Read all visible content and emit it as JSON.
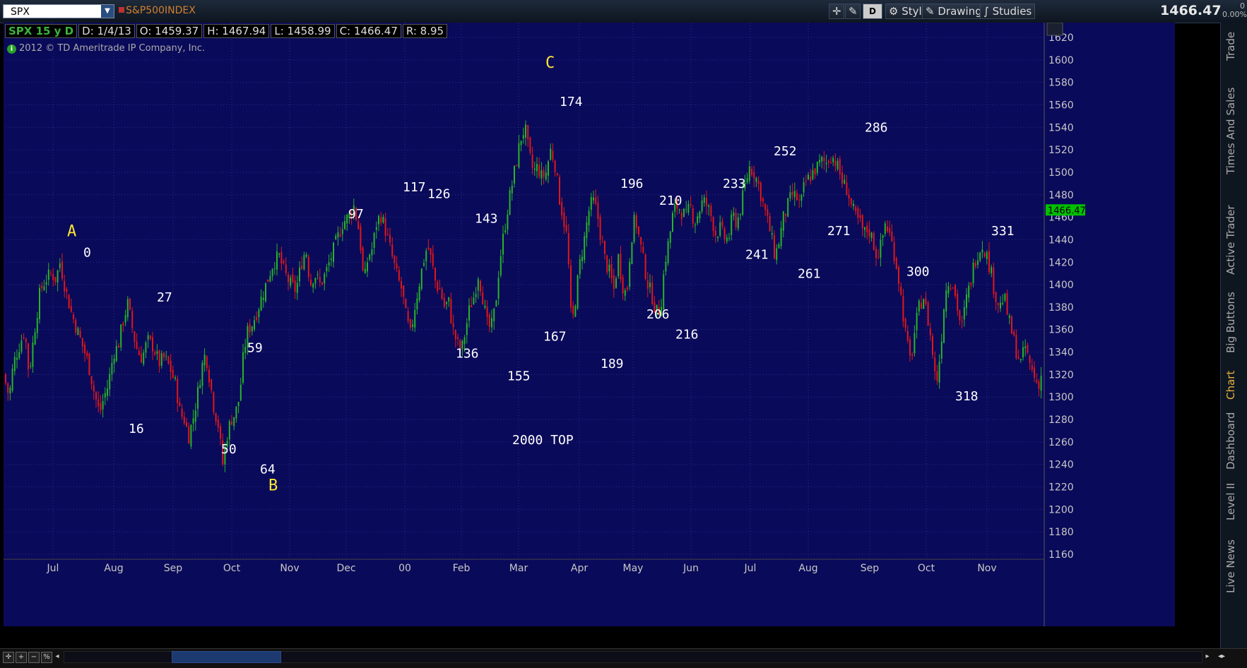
{
  "toolbar": {
    "symbol": "SPX",
    "description": "S&P500INDEX",
    "period_btn": "D",
    "style_label": "Style",
    "drawings_label": "Drawings",
    "studies_label": "Studies",
    "last_price": "1466.47",
    "change_top": "0",
    "change_pct": "0.00%"
  },
  "info_bar": {
    "symbol_period": "SPX 15 y D",
    "date": "D: 1/4/13",
    "open": "O: 1459.37",
    "high": "H: 1467.94",
    "low": "L: 1458.99",
    "close": "C: 1466.47",
    "range": "R: 8.95"
  },
  "copyright": "2012 © TD Ameritrade IP Company, Inc.",
  "side_tabs": [
    "Trade",
    "Times And Sales",
    "Active Trader",
    "Big Buttons",
    "Chart",
    "Dashboard",
    "Level II",
    "Live News"
  ],
  "side_active": "Chart",
  "colors": {
    "background": "#0a0a5a",
    "up_candle": "#28b428",
    "down_candle": "#e01818",
    "annotation": "#ffffff",
    "wave_label": "#ffe830",
    "price_tag": "#00c000"
  },
  "chart_data": {
    "type": "candlestick",
    "title": "",
    "xlabel": "",
    "ylabel": "",
    "ylim": [
      1160,
      1620
    ],
    "y_ticks": [
      1160,
      1180,
      1200,
      1220,
      1240,
      1260,
      1280,
      1300,
      1320,
      1340,
      1360,
      1380,
      1400,
      1420,
      1440,
      1460,
      1480,
      1500,
      1520,
      1540,
      1560,
      1580,
      1600,
      1620
    ],
    "x_months": [
      "Jul",
      "Aug",
      "Sep",
      "Oct",
      "Nov",
      "Dec",
      "00",
      "Feb",
      "Mar",
      "Apr",
      "May",
      "Jun",
      "Jul",
      "Aug",
      "Sep",
      "Oct",
      "Nov"
    ],
    "current_price_tag": "1466.47",
    "path_anchors": [
      [
        0,
        1320
      ],
      [
        8,
        1300
      ],
      [
        14,
        1330
      ],
      [
        22,
        1345
      ],
      [
        30,
        1360
      ],
      [
        36,
        1320
      ],
      [
        44,
        1360
      ],
      [
        52,
        1395
      ],
      [
        60,
        1405
      ],
      [
        68,
        1410
      ],
      [
        74,
        1405
      ],
      [
        80,
        1420
      ],
      [
        88,
        1395
      ],
      [
        96,
        1375
      ],
      [
        104,
        1360
      ],
      [
        112,
        1345
      ],
      [
        120,
        1330
      ],
      [
        128,
        1305
      ],
      [
        136,
        1285
      ],
      [
        142,
        1300
      ],
      [
        148,
        1310
      ],
      [
        156,
        1340
      ],
      [
        162,
        1345
      ],
      [
        170,
        1370
      ],
      [
        176,
        1383
      ],
      [
        184,
        1355
      ],
      [
        190,
        1340
      ],
      [
        196,
        1335
      ],
      [
        204,
        1350
      ],
      [
        212,
        1345
      ],
      [
        220,
        1330
      ],
      [
        228,
        1335
      ],
      [
        236,
        1325
      ],
      [
        244,
        1310
      ],
      [
        250,
        1285
      ],
      [
        256,
        1280
      ],
      [
        262,
        1265
      ],
      [
        268,
        1280
      ],
      [
        274,
        1300
      ],
      [
        280,
        1325
      ],
      [
        286,
        1340
      ],
      [
        292,
        1315
      ],
      [
        298,
        1290
      ],
      [
        304,
        1275
      ],
      [
        310,
        1240
      ],
      [
        316,
        1265
      ],
      [
        322,
        1280
      ],
      [
        328,
        1285
      ],
      [
        334,
        1300
      ],
      [
        340,
        1340
      ],
      [
        346,
        1360
      ],
      [
        352,
        1365
      ],
      [
        358,
        1375
      ],
      [
        366,
        1390
      ],
      [
        374,
        1405
      ],
      [
        382,
        1420
      ],
      [
        390,
        1425
      ],
      [
        398,
        1410
      ],
      [
        406,
        1400
      ],
      [
        414,
        1395
      ],
      [
        422,
        1420
      ],
      [
        428,
        1432
      ],
      [
        434,
        1400
      ],
      [
        440,
        1410
      ],
      [
        448,
        1400
      ],
      [
        456,
        1410
      ],
      [
        464,
        1425
      ],
      [
        472,
        1440
      ],
      [
        480,
        1455
      ],
      [
        488,
        1460
      ],
      [
        496,
        1470
      ],
      [
        504,
        1445
      ],
      [
        510,
        1400
      ],
      [
        516,
        1425
      ],
      [
        522,
        1432
      ],
      [
        528,
        1455
      ],
      [
        534,
        1462
      ],
      [
        540,
        1450
      ],
      [
        546,
        1435
      ],
      [
        552,
        1420
      ],
      [
        558,
        1405
      ],
      [
        564,
        1395
      ],
      [
        570,
        1370
      ],
      [
        576,
        1355
      ],
      [
        582,
        1380
      ],
      [
        588,
        1400
      ],
      [
        594,
        1420
      ],
      [
        600,
        1435
      ],
      [
        606,
        1420
      ],
      [
        612,
        1400
      ],
      [
        618,
        1395
      ],
      [
        624,
        1380
      ],
      [
        630,
        1385
      ],
      [
        636,
        1360
      ],
      [
        642,
        1348
      ],
      [
        648,
        1340
      ],
      [
        654,
        1360
      ],
      [
        660,
        1380
      ],
      [
        666,
        1390
      ],
      [
        672,
        1410
      ],
      [
        678,
        1390
      ],
      [
        684,
        1365
      ],
      [
        690,
        1360
      ],
      [
        696,
        1380
      ],
      [
        702,
        1420
      ],
      [
        708,
        1445
      ],
      [
        714,
        1470
      ],
      [
        720,
        1490
      ],
      [
        726,
        1510
      ],
      [
        732,
        1530
      ],
      [
        738,
        1540
      ],
      [
        744,
        1515
      ],
      [
        750,
        1500
      ],
      [
        756,
        1505
      ],
      [
        762,
        1495
      ],
      [
        768,
        1500
      ],
      [
        774,
        1520
      ],
      [
        780,
        1510
      ],
      [
        786,
        1480
      ],
      [
        792,
        1460
      ],
      [
        798,
        1440
      ],
      [
        804,
        1360
      ],
      [
        810,
        1390
      ],
      [
        816,
        1420
      ],
      [
        822,
        1440
      ],
      [
        828,
        1465
      ],
      [
        834,
        1475
      ],
      [
        840,
        1465
      ],
      [
        846,
        1440
      ],
      [
        852,
        1420
      ],
      [
        858,
        1410
      ],
      [
        864,
        1395
      ],
      [
        870,
        1425
      ],
      [
        876,
        1400
      ],
      [
        882,
        1390
      ],
      [
        888,
        1440
      ],
      [
        894,
        1460
      ],
      [
        900,
        1440
      ],
      [
        906,
        1420
      ],
      [
        912,
        1400
      ],
      [
        918,
        1390
      ],
      [
        924,
        1375
      ],
      [
        930,
        1380
      ],
      [
        936,
        1420
      ],
      [
        942,
        1440
      ],
      [
        948,
        1465
      ],
      [
        954,
        1470
      ],
      [
        960,
        1465
      ],
      [
        966,
        1460
      ],
      [
        972,
        1470
      ],
      [
        978,
        1455
      ],
      [
        984,
        1465
      ],
      [
        990,
        1475
      ],
      [
        996,
        1470
      ],
      [
        1002,
        1460
      ],
      [
        1008,
        1445
      ],
      [
        1014,
        1450
      ],
      [
        1020,
        1442
      ],
      [
        1026,
        1440
      ],
      [
        1032,
        1462
      ],
      [
        1038,
        1455
      ],
      [
        1044,
        1470
      ],
      [
        1050,
        1490
      ],
      [
        1056,
        1505
      ],
      [
        1062,
        1500
      ],
      [
        1068,
        1490
      ],
      [
        1074,
        1475
      ],
      [
        1080,
        1460
      ],
      [
        1086,
        1445
      ],
      [
        1092,
        1425
      ],
      [
        1098,
        1440
      ],
      [
        1104,
        1460
      ],
      [
        1110,
        1470
      ],
      [
        1116,
        1480
      ],
      [
        1122,
        1478
      ],
      [
        1128,
        1470
      ],
      [
        1134,
        1490
      ],
      [
        1140,
        1495
      ],
      [
        1146,
        1500
      ],
      [
        1152,
        1505
      ],
      [
        1158,
        1510
      ],
      [
        1164,
        1508
      ],
      [
        1170,
        1515
      ],
      [
        1176,
        1512
      ],
      [
        1182,
        1502
      ],
      [
        1188,
        1490
      ],
      [
        1194,
        1485
      ],
      [
        1200,
        1470
      ],
      [
        1206,
        1460
      ],
      [
        1212,
        1455
      ],
      [
        1218,
        1445
      ],
      [
        1224,
        1450
      ],
      [
        1230,
        1440
      ],
      [
        1236,
        1425
      ],
      [
        1242,
        1435
      ],
      [
        1248,
        1455
      ],
      [
        1254,
        1445
      ],
      [
        1260,
        1430
      ],
      [
        1266,
        1410
      ],
      [
        1272,
        1380
      ],
      [
        1278,
        1350
      ],
      [
        1284,
        1330
      ],
      [
        1290,
        1360
      ],
      [
        1296,
        1380
      ],
      [
        1302,
        1390
      ],
      [
        1308,
        1370
      ],
      [
        1314,
        1345
      ],
      [
        1320,
        1310
      ],
      [
        1326,
        1340
      ],
      [
        1332,
        1390
      ],
      [
        1338,
        1405
      ],
      [
        1344,
        1400
      ],
      [
        1350,
        1380
      ],
      [
        1356,
        1360
      ],
      [
        1362,
        1385
      ],
      [
        1368,
        1400
      ],
      [
        1374,
        1420
      ],
      [
        1380,
        1430
      ],
      [
        1386,
        1436
      ],
      [
        1392,
        1425
      ],
      [
        1398,
        1410
      ],
      [
        1404,
        1390
      ],
      [
        1410,
        1380
      ],
      [
        1416,
        1390
      ],
      [
        1422,
        1370
      ],
      [
        1428,
        1355
      ],
      [
        1434,
        1340
      ],
      [
        1440,
        1330
      ],
      [
        1446,
        1345
      ],
      [
        1452,
        1330
      ],
      [
        1458,
        1320
      ],
      [
        1464,
        1310
      ],
      [
        1468,
        1320
      ],
      [
        1472,
        1310
      ]
    ],
    "annotations": [
      {
        "text": "A",
        "x": 90,
        "price": 1443,
        "kind": "wave"
      },
      {
        "text": "0",
        "x": 113,
        "price": 1425,
        "kind": "count"
      },
      {
        "text": "27",
        "x": 217,
        "price": 1385,
        "kind": "count"
      },
      {
        "text": "16",
        "x": 177,
        "price": 1268,
        "kind": "count"
      },
      {
        "text": "59",
        "x": 345,
        "price": 1340,
        "kind": "count"
      },
      {
        "text": "50",
        "x": 308,
        "price": 1250,
        "kind": "count"
      },
      {
        "text": "64",
        "x": 363,
        "price": 1232,
        "kind": "count"
      },
      {
        "text": "B",
        "x": 375,
        "price": 1217,
        "kind": "wave"
      },
      {
        "text": "97",
        "x": 488,
        "price": 1459,
        "kind": "count"
      },
      {
        "text": "117",
        "x": 565,
        "price": 1483,
        "kind": "count"
      },
      {
        "text": "126",
        "x": 600,
        "price": 1477,
        "kind": "count"
      },
      {
        "text": "143",
        "x": 667,
        "price": 1455,
        "kind": "count"
      },
      {
        "text": "136",
        "x": 640,
        "price": 1335,
        "kind": "count"
      },
      {
        "text": "155",
        "x": 713,
        "price": 1315,
        "kind": "count"
      },
      {
        "text": "167",
        "x": 764,
        "price": 1350,
        "kind": "count"
      },
      {
        "text": "C",
        "x": 767,
        "price": 1593,
        "kind": "wave"
      },
      {
        "text": "174",
        "x": 787,
        "price": 1559,
        "kind": "count"
      },
      {
        "text": "189",
        "x": 845,
        "price": 1326,
        "kind": "count"
      },
      {
        "text": "196",
        "x": 873,
        "price": 1486,
        "kind": "count"
      },
      {
        "text": "210",
        "x": 928,
        "price": 1471,
        "kind": "count"
      },
      {
        "text": "206",
        "x": 910,
        "price": 1370,
        "kind": "count"
      },
      {
        "text": "216",
        "x": 951,
        "price": 1352,
        "kind": "count"
      },
      {
        "text": "233",
        "x": 1018,
        "price": 1486,
        "kind": "count"
      },
      {
        "text": "241",
        "x": 1050,
        "price": 1423,
        "kind": "count"
      },
      {
        "text": "252",
        "x": 1090,
        "price": 1515,
        "kind": "count"
      },
      {
        "text": "261",
        "x": 1124,
        "price": 1406,
        "kind": "count"
      },
      {
        "text": "271",
        "x": 1166,
        "price": 1444,
        "kind": "count"
      },
      {
        "text": "286",
        "x": 1219,
        "price": 1536,
        "kind": "count"
      },
      {
        "text": "300",
        "x": 1278,
        "price": 1408,
        "kind": "count"
      },
      {
        "text": "318",
        "x": 1347,
        "price": 1297,
        "kind": "count"
      },
      {
        "text": "331",
        "x": 1398,
        "price": 1444,
        "kind": "count"
      },
      {
        "text": "2000  TOP",
        "x": 720,
        "price": 1258,
        "kind": "note"
      }
    ]
  }
}
